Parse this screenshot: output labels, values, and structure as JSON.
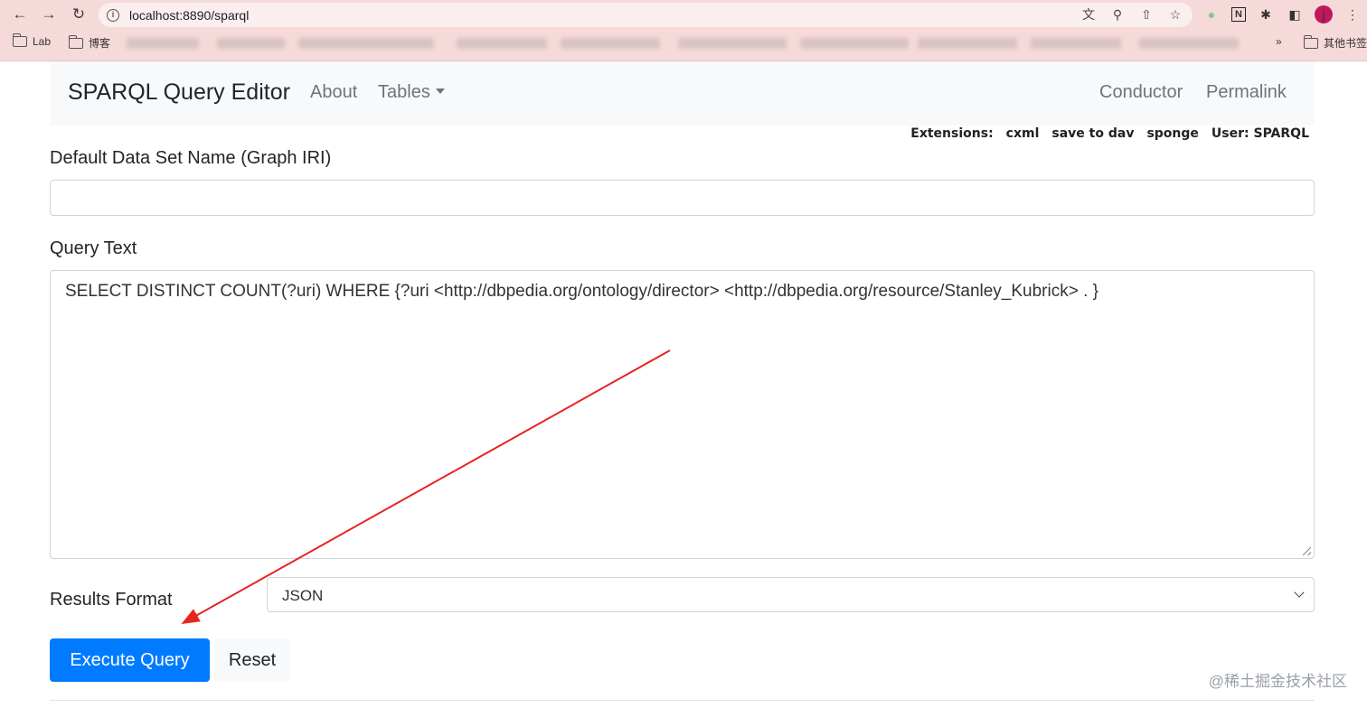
{
  "browser": {
    "url": "localhost:8890/sparql",
    "bookmarks": [
      {
        "label": "Lab"
      },
      {
        "label": "博客"
      }
    ],
    "bookmarks_overflow": "»",
    "other_bookmarks": "其他书签",
    "avatar_letter": "j"
  },
  "navbar": {
    "brand": "SPARQL Query Editor",
    "about": "About",
    "tables": "Tables",
    "conductor": "Conductor",
    "permalink": "Permalink"
  },
  "extensions": {
    "label": "Extensions:",
    "items": [
      "cxml",
      "save to dav",
      "sponge"
    ],
    "user_label": "User:",
    "user_value": "SPARQL"
  },
  "form": {
    "graph_label": "Default Data Set Name (Graph IRI)",
    "graph_value": "",
    "query_label": "Query Text",
    "query_text": "SELECT DISTINCT COUNT(?uri) WHERE {?uri <http://dbpedia.org/ontology/director> <http://dbpedia.org/resource/Stanley_Kubrick>  . }",
    "format_label": "Results Format",
    "format_value": "JSON",
    "execute_label": "Execute Query",
    "reset_label": "Reset"
  },
  "watermark": "@稀土掘金技术社区",
  "annotation_color": "#e8231e"
}
